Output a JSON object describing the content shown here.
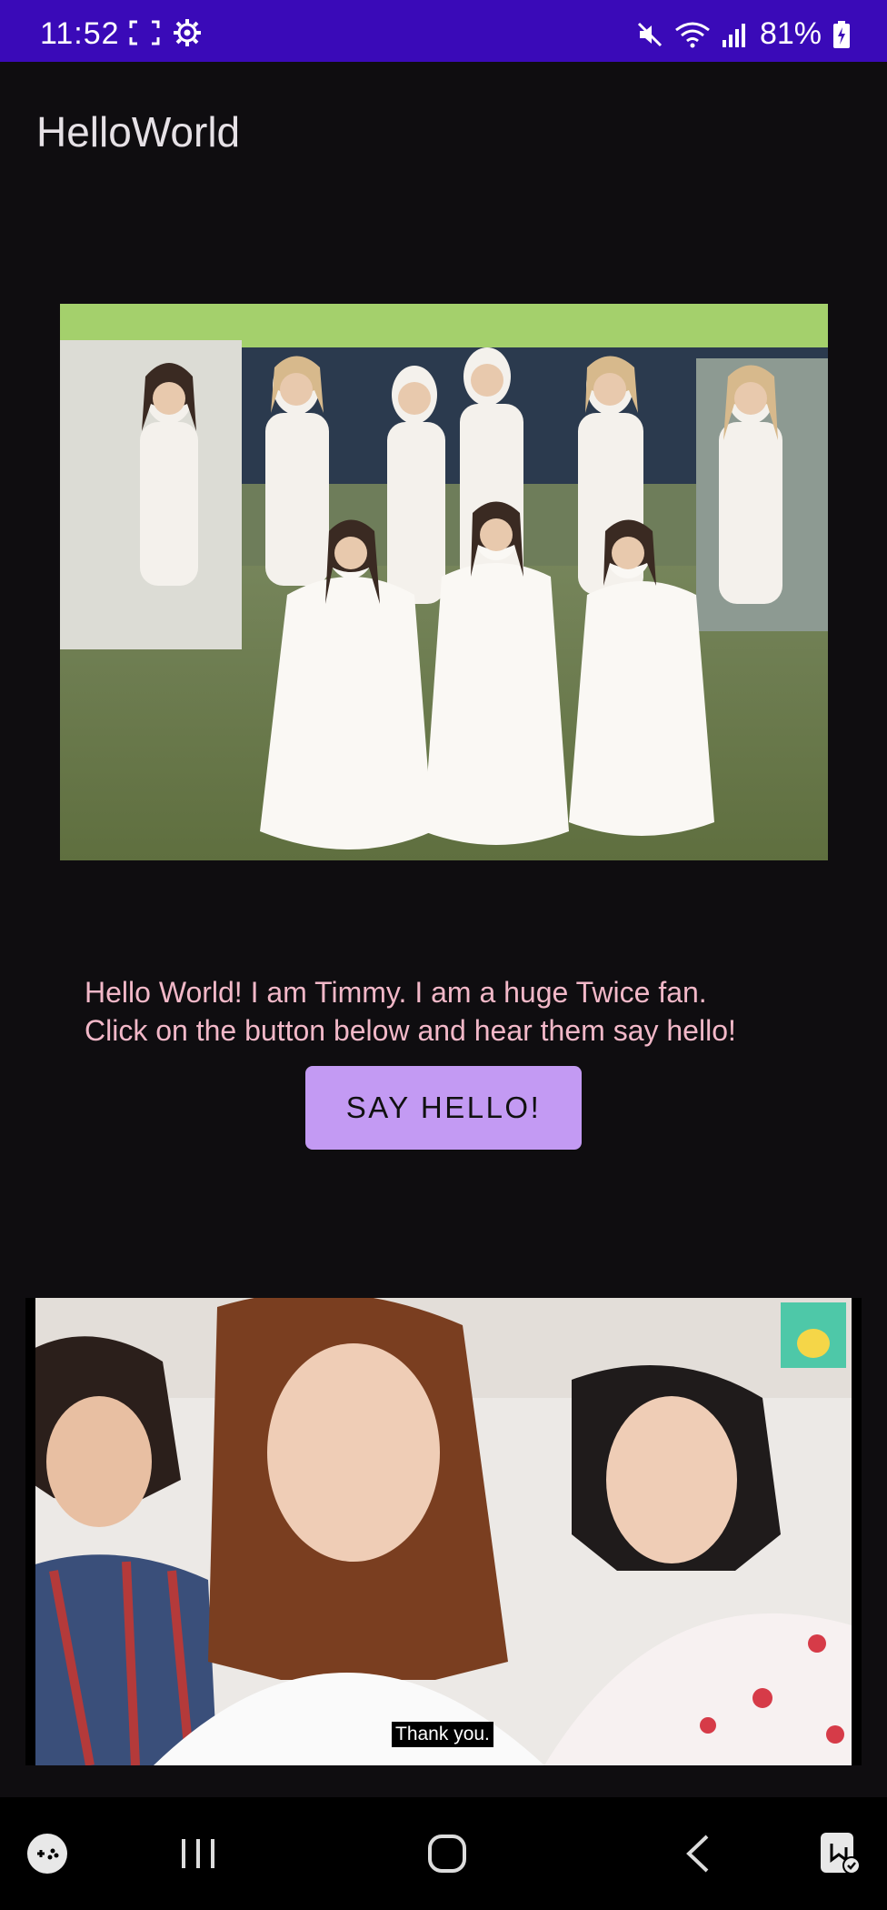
{
  "status_bar": {
    "time": "11:52",
    "battery": "81%",
    "icons": [
      "screenshot-icon",
      "settings-gear-icon",
      "mute-icon",
      "wifi-icon",
      "signal-icon",
      "battery-charging-icon"
    ]
  },
  "app_bar": {
    "title": "HelloWorld"
  },
  "main": {
    "message_line1": "Hello World! I am Timmy. I am a huge Twice fan.",
    "message_line2": "Click on the button below and hear them say hello!",
    "button_label": "SAY HELLO!"
  },
  "video": {
    "caption": "Thank you."
  },
  "nav_bar": {
    "items": [
      "game-launcher-icon",
      "recents-icon",
      "home-icon",
      "back-icon",
      "accessibility-icon"
    ]
  },
  "colors": {
    "status_bar": "#3a0ab8",
    "background": "#0f0d10",
    "message_text": "#f2b8c8",
    "button_bg": "#c39af3"
  }
}
